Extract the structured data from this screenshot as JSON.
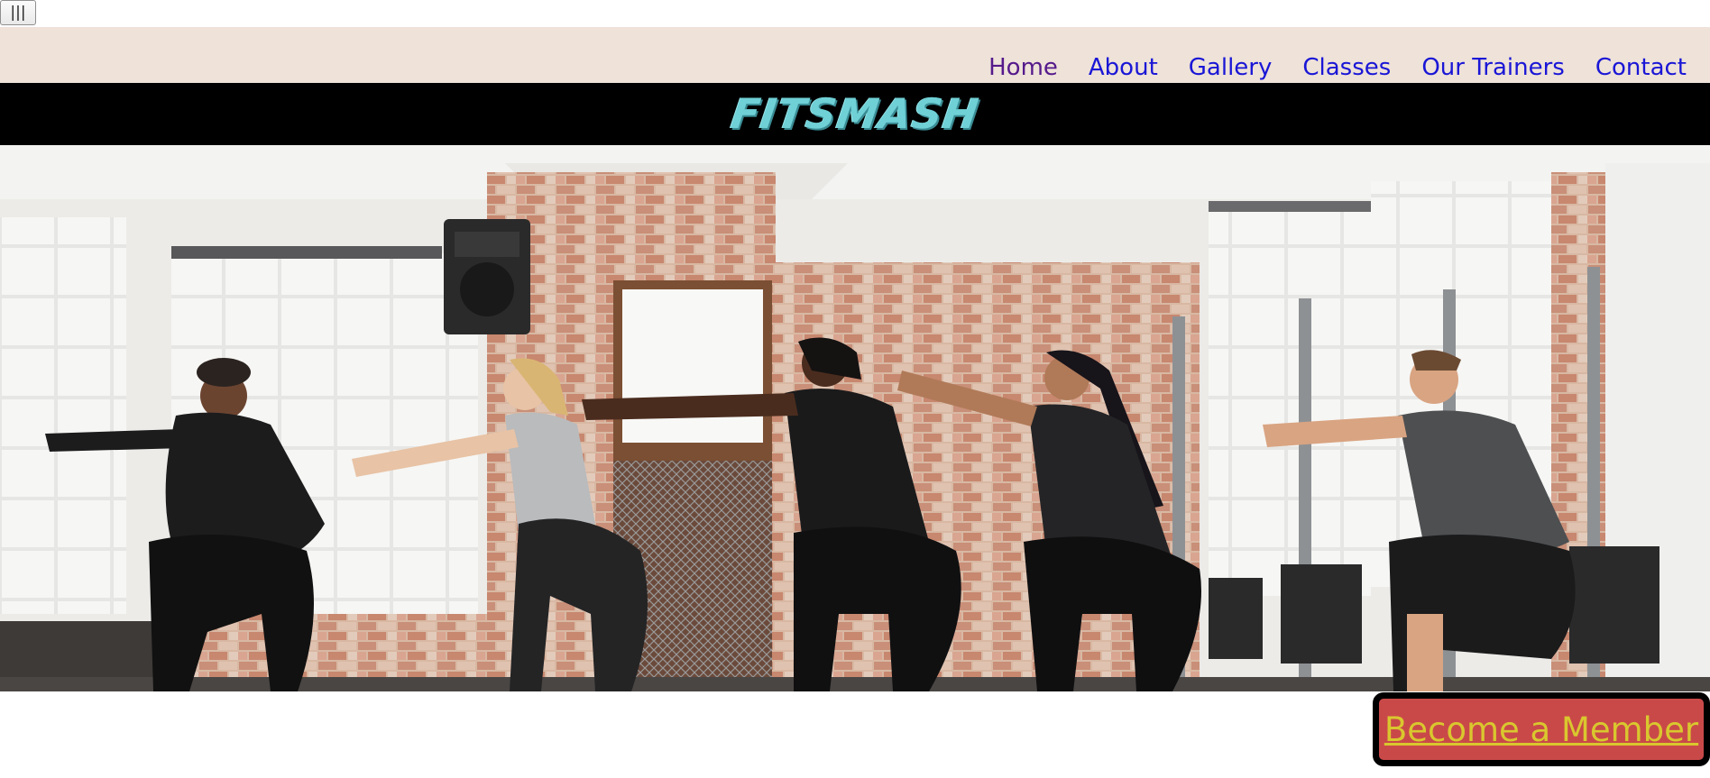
{
  "toolbar": {
    "menu_toggle_label": "|||"
  },
  "nav": {
    "items": [
      {
        "label": "Home",
        "visited": true
      },
      {
        "label": "About"
      },
      {
        "label": "Gallery"
      },
      {
        "label": "Classes"
      },
      {
        "label": "Our Trainers"
      },
      {
        "label": "Contact"
      }
    ]
  },
  "brand": {
    "title": "FITSMASH",
    "color": "#6fd0d6"
  },
  "hero": {
    "image_subject": "group fitness class doing squats in brick-walled gym"
  },
  "cta": {
    "label": "Become a Member",
    "background_color": "#c94949",
    "text_color": "#d9c72e"
  },
  "colors": {
    "nav_background": "#eee2d9",
    "nav_link": "#1a16d6",
    "nav_link_visited": "#551a8b",
    "brand_bar": "#000000"
  }
}
